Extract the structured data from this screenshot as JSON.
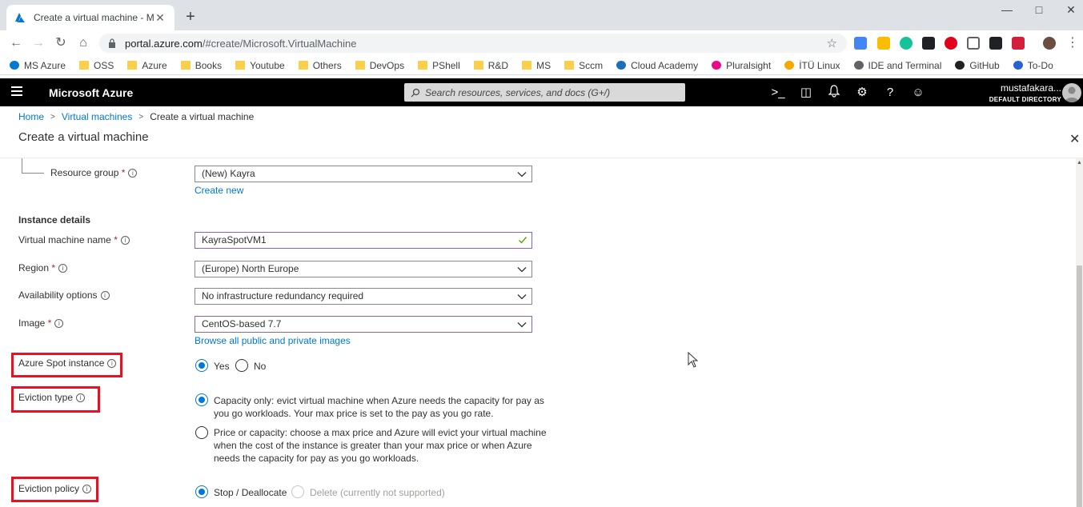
{
  "browser": {
    "tab_title": "Create a virtual machine - Micros",
    "url_host": "portal.azure.com",
    "url_path": "/#create/Microsoft.VirtualMachine",
    "bookmarks": [
      {
        "label": "MS Azure",
        "icon": "azure-icon"
      },
      {
        "label": "OSS",
        "icon": "folder-icon"
      },
      {
        "label": "Azure",
        "icon": "folder-icon"
      },
      {
        "label": "Books",
        "icon": "folder-icon"
      },
      {
        "label": "Youtube",
        "icon": "folder-icon"
      },
      {
        "label": "Others",
        "icon": "folder-icon"
      },
      {
        "label": "DevOps",
        "icon": "folder-icon"
      },
      {
        "label": "PShell",
        "icon": "folder-icon"
      },
      {
        "label": "R&D",
        "icon": "folder-icon"
      },
      {
        "label": "MS",
        "icon": "folder-icon"
      },
      {
        "label": "Sccm",
        "icon": "folder-icon"
      },
      {
        "label": "Cloud Academy",
        "icon": "cloud-academy-icon"
      },
      {
        "label": "Pluralsight",
        "icon": "pluralsight-icon"
      },
      {
        "label": "İTÜ Linux",
        "icon": "itu-icon"
      },
      {
        "label": "IDE and Terminal",
        "icon": "ide-icon"
      },
      {
        "label": "GitHub",
        "icon": "github-icon"
      },
      {
        "label": "To-Do",
        "icon": "todo-icon"
      }
    ]
  },
  "portal": {
    "brand": "Microsoft Azure",
    "search_placeholder": "Search resources, services, and docs (G+/)",
    "user_name": "mustafakara...",
    "user_directory": "DEFAULT DIRECTORY"
  },
  "breadcrumb": {
    "home": "Home",
    "virtual_machines": "Virtual machines",
    "current": "Create a virtual machine"
  },
  "page": {
    "title": "Create a virtual machine"
  },
  "form": {
    "resource_group": {
      "label": "Resource group",
      "required": "*",
      "value": "(New) Kayra",
      "create_new": "Create new"
    },
    "instance_details": "Instance details",
    "vm_name": {
      "label": "Virtual machine name",
      "required": "*",
      "value": "KayraSpotVM1"
    },
    "region": {
      "label": "Region",
      "required": "*",
      "value": "(Europe) North Europe"
    },
    "availability": {
      "label": "Availability options",
      "value": "No infrastructure redundancy required"
    },
    "image": {
      "label": "Image",
      "required": "*",
      "value": "CentOS-based 7.7",
      "browse": "Browse all public and private images"
    },
    "spot": {
      "label": "Azure Spot instance",
      "yes": "Yes",
      "no": "No",
      "selected": "Yes"
    },
    "eviction_type": {
      "label": "Eviction type",
      "option1_line1": "Capacity only: evict virtual machine when Azure needs the capacity for pay as",
      "option1_line2": "you go workloads. Your max price is set to the pay as you go rate.",
      "option2_line1": "Price or capacity: choose a max price and Azure will evict your virtual machine",
      "option2_line2": "when the cost of the instance is greater than your max price or when Azure",
      "option2_line3": "needs the capacity for pay as you go workloads.",
      "selected": "Capacity only"
    },
    "eviction_policy": {
      "label": "Eviction policy",
      "option1": "Stop / Deallocate",
      "option2": "Delete (currently not supported)",
      "selected": "Stop / Deallocate"
    }
  },
  "colors": {
    "azure_blue": "#0078d4",
    "highlight_red": "#e81123",
    "header_black": "#000000"
  }
}
